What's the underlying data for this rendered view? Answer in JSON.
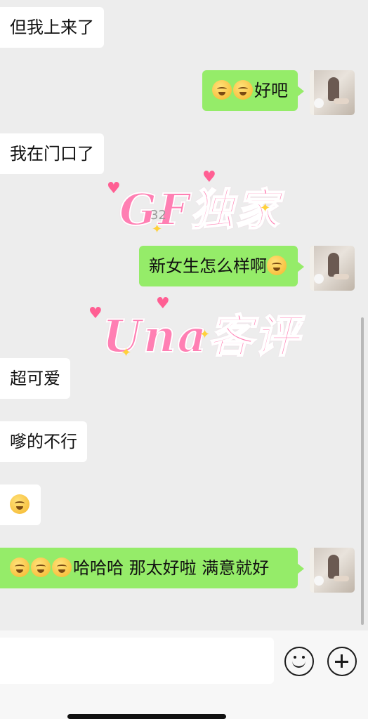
{
  "messages": [
    {
      "side": "recv",
      "text": "但我上来了"
    },
    {
      "side": "sent",
      "emoji_count": 2,
      "text": "好吧"
    },
    {
      "side": "recv",
      "text": "我在门口了"
    },
    {
      "side": "sent",
      "text": "新女生怎么样啊",
      "trailing_emoji": true
    },
    {
      "side": "recv",
      "text": "超可爱"
    },
    {
      "side": "recv",
      "text": "嗲的不行"
    },
    {
      "side": "recv",
      "emoji_only": true
    },
    {
      "side": "sent",
      "emoji_count": 3,
      "text": "哈哈哈 那太好啦 满意就好"
    }
  ],
  "watermark": {
    "line1": "GF独家",
    "line2": "Una客评",
    "stray": "32"
  },
  "colors": {
    "sent_bubble": "#95ec69",
    "recv_bubble": "#ffffff",
    "background": "#ededed",
    "watermark": "#ff7fb3"
  },
  "icons": {
    "emoji_button": "smile-face-icon",
    "plus_button": "plus-circle-icon"
  }
}
